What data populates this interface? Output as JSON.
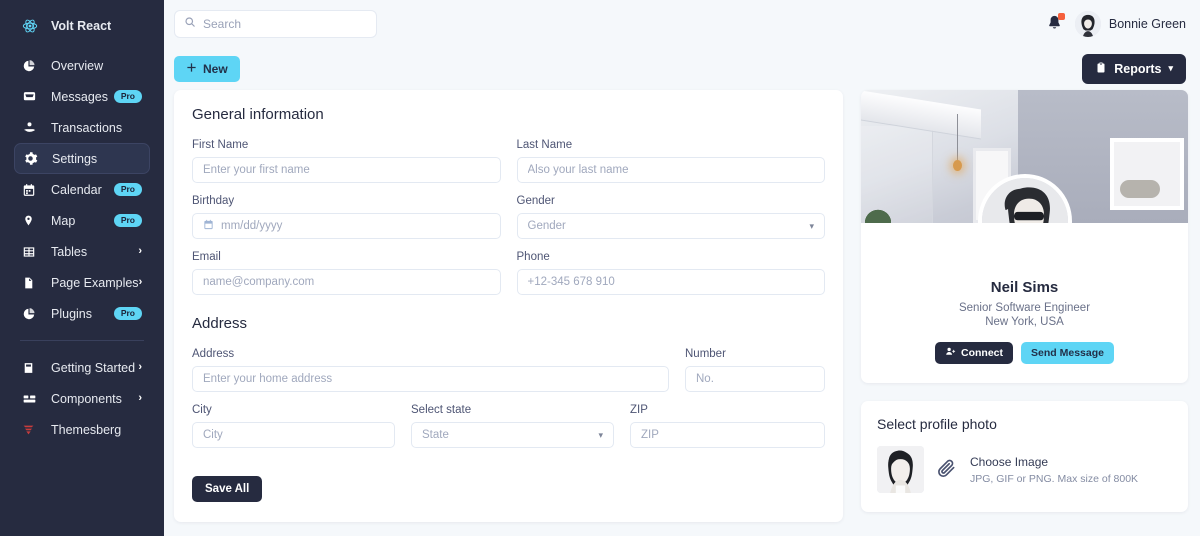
{
  "sidebar": {
    "brand": "Volt React",
    "items": [
      {
        "label": "Overview",
        "icon": "pie-chart-icon",
        "badge": "",
        "chevron": false,
        "active": false
      },
      {
        "label": "Messages",
        "icon": "inbox-icon",
        "badge": "Pro",
        "chevron": false,
        "active": false
      },
      {
        "label": "Transactions",
        "icon": "hand-coin-icon",
        "badge": "",
        "chevron": false,
        "active": false
      },
      {
        "label": "Settings",
        "icon": "gear-icon",
        "badge": "",
        "chevron": false,
        "active": true
      },
      {
        "label": "Calendar",
        "icon": "calendar-icon",
        "badge": "Pro",
        "chevron": false,
        "active": false
      },
      {
        "label": "Map",
        "icon": "map-pin-icon",
        "badge": "",
        "chevron": false,
        "active": false,
        "badge2": "Pro"
      },
      {
        "label": "Tables",
        "icon": "table-grid-icon",
        "badge": "",
        "chevron": true,
        "active": false
      },
      {
        "label": "Page Examples",
        "icon": "document-icon",
        "badge": "",
        "chevron": true,
        "active": false
      },
      {
        "label": "Plugins",
        "icon": "pie-chart-icon",
        "badge": "Pro",
        "chevron": false,
        "active": false
      }
    ],
    "items_bottom": [
      {
        "label": "Getting Started",
        "icon": "book-icon",
        "badge": "",
        "chevron": true
      },
      {
        "label": "Components",
        "icon": "components-icon",
        "badge": "",
        "chevron": true
      },
      {
        "label": "Themesberg",
        "icon": "themesberg-icon",
        "badge": "",
        "chevron": false
      }
    ]
  },
  "topbar": {
    "search_placeholder": "Search",
    "search_value": "",
    "user_name": "Bonnie Green",
    "has_notification": true
  },
  "actionbar": {
    "new_label": "New",
    "reports_label": "Reports"
  },
  "form": {
    "general_title": "General information",
    "address_title": "Address",
    "save_label": "Save All",
    "fields": {
      "first_name": {
        "label": "First Name",
        "placeholder": "Enter your first name",
        "value": ""
      },
      "last_name": {
        "label": "Last Name",
        "placeholder": "Also your last name",
        "value": ""
      },
      "birthday": {
        "label": "Birthday",
        "placeholder": "mm/dd/yyyy",
        "value": ""
      },
      "gender": {
        "label": "Gender",
        "placeholder": "Gender",
        "value": ""
      },
      "email": {
        "label": "Email",
        "placeholder": "name@company.com",
        "value": ""
      },
      "phone": {
        "label": "Phone",
        "placeholder": "+12-345 678 910",
        "value": ""
      },
      "address": {
        "label": "Address",
        "placeholder": "Enter your home address",
        "value": ""
      },
      "number": {
        "label": "Number",
        "placeholder": "No.",
        "value": ""
      },
      "city": {
        "label": "City",
        "placeholder": "City",
        "value": ""
      },
      "state": {
        "label": "Select state",
        "placeholder": "State",
        "value": ""
      },
      "zip": {
        "label": "ZIP",
        "placeholder": "ZIP",
        "value": ""
      }
    }
  },
  "profile": {
    "name": "Neil Sims",
    "role": "Senior Software Engineer",
    "location": "New York, USA",
    "connect_label": "Connect",
    "message_label": "Send Message"
  },
  "photo": {
    "title": "Select profile photo",
    "choose_label": "Choose Image",
    "hint": "JPG, GIF or PNG. Max size of 800K"
  },
  "colors": {
    "sidebar_bg": "#262b40",
    "accent_cyan": "#5ed5f5",
    "page_bg": "#f5f8fb",
    "notification_dot": "#f5603c",
    "themesberg_red": "#c93c3c"
  }
}
